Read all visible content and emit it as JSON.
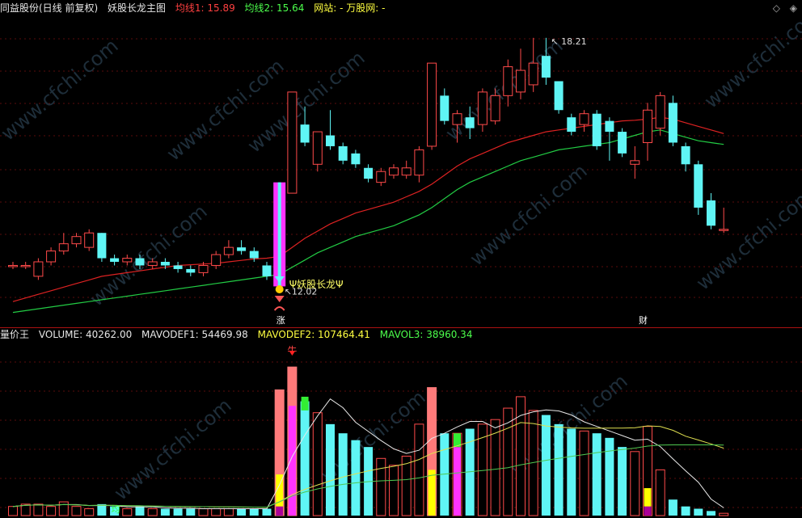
{
  "main_header": {
    "stock": "同益股份(日线 前复权)",
    "indicator": "妖股长龙主图",
    "ma1_label": "均线1: ",
    "ma1_value": "15.89",
    "ma2_label": "均线2: ",
    "ma2_value": "15.64",
    "site_label": "网站: - 万股网: -"
  },
  "volume_header": {
    "indicator": "量价王",
    "volume": "VOLUME: 40262.00",
    "mavodef1": "MAVODEF1: 54469.98",
    "mavodef2": "MAVODEF2: 107464.41",
    "mavol3": "MAVOL3: 38960.34"
  },
  "annotations": {
    "high_label": "18.21",
    "low_label": "12.02",
    "yaogu_label": "Ψ妖股长龙Ψ",
    "zhang": "涨",
    "cai": "财",
    "niu": "牛",
    "ma_tag": "均"
  },
  "watermark": "www.cfchi.com",
  "icons": {
    "diamond": "◇",
    "double_diamond": "◈"
  },
  "colors": {
    "up": "#ff4a4a",
    "down": "#5ff5f5",
    "ma_red": "#dd2222",
    "ma_green": "#22cc44",
    "vol_white": "#e8e8e8",
    "vol_yellow": "#e0e050",
    "vol_green": "#50c850",
    "magenta": "#ff33ff",
    "pink": "#ff7a7a"
  },
  "chart_data": {
    "type": "candlestick",
    "price_ylim": [
      11,
      19.5
    ],
    "candles": [
      {
        "o": 12.6,
        "c": 12.6,
        "h": 12.7,
        "l": 12.5
      },
      {
        "o": 12.6,
        "c": 12.6,
        "h": 12.7,
        "l": 12.5
      },
      {
        "o": 12.3,
        "c": 12.7,
        "h": 12.8,
        "l": 12.2
      },
      {
        "o": 12.7,
        "c": 13.0,
        "h": 13.1,
        "l": 12.6
      },
      {
        "o": 13.0,
        "c": 13.2,
        "h": 13.5,
        "l": 12.9
      },
      {
        "o": 13.2,
        "c": 13.4,
        "h": 13.5,
        "l": 13.1
      },
      {
        "o": 13.1,
        "c": 13.5,
        "h": 13.6,
        "l": 13.0
      },
      {
        "o": 13.5,
        "c": 12.8,
        "h": 13.5,
        "l": 12.7
      },
      {
        "o": 12.8,
        "c": 12.7,
        "h": 12.9,
        "l": 12.6
      },
      {
        "o": 12.7,
        "c": 12.8,
        "h": 12.9,
        "l": 12.6
      },
      {
        "o": 12.8,
        "c": 12.6,
        "h": 12.9,
        "l": 12.5
      },
      {
        "o": 12.6,
        "c": 12.7,
        "h": 12.8,
        "l": 12.5
      },
      {
        "o": 12.7,
        "c": 12.6,
        "h": 12.8,
        "l": 12.5
      },
      {
        "o": 12.6,
        "c": 12.5,
        "h": 12.7,
        "l": 12.4
      },
      {
        "o": 12.5,
        "c": 12.4,
        "h": 12.6,
        "l": 12.3
      },
      {
        "o": 12.4,
        "c": 12.6,
        "h": 12.7,
        "l": 12.3
      },
      {
        "o": 12.6,
        "c": 12.9,
        "h": 13.0,
        "l": 12.5
      },
      {
        "o": 12.9,
        "c": 13.1,
        "h": 13.3,
        "l": 12.8
      },
      {
        "o": 13.1,
        "c": 13.0,
        "h": 13.3,
        "l": 12.9
      },
      {
        "o": 13.0,
        "c": 12.8,
        "h": 13.1,
        "l": 12.7
      },
      {
        "o": 12.6,
        "c": 12.3,
        "h": 12.7,
        "l": 12.2
      },
      {
        "o": 12.02,
        "c": 14.9,
        "h": 14.9,
        "l": 12.02
      },
      {
        "o": 14.6,
        "c": 17.4,
        "h": 17.4,
        "l": 14.6
      },
      {
        "o": 16.5,
        "c": 16.0,
        "h": 17.0,
        "l": 15.9
      },
      {
        "o": 15.4,
        "c": 16.3,
        "h": 16.3,
        "l": 15.2
      },
      {
        "o": 16.2,
        "c": 15.9,
        "h": 16.9,
        "l": 15.8
      },
      {
        "o": 15.9,
        "c": 15.5,
        "h": 16.0,
        "l": 15.4
      },
      {
        "o": 15.7,
        "c": 15.4,
        "h": 15.8,
        "l": 15.3
      },
      {
        "o": 15.3,
        "c": 15.0,
        "h": 15.4,
        "l": 14.9
      },
      {
        "o": 14.9,
        "c": 15.2,
        "h": 15.3,
        "l": 14.8
      },
      {
        "o": 15.1,
        "c": 15.3,
        "h": 15.4,
        "l": 15.0
      },
      {
        "o": 15.1,
        "c": 15.3,
        "h": 15.5,
        "l": 15.0
      },
      {
        "o": 15.1,
        "c": 15.8,
        "h": 15.9,
        "l": 14.9
      },
      {
        "o": 15.9,
        "c": 18.2,
        "h": 18.2,
        "l": 15.8
      },
      {
        "o": 17.3,
        "c": 16.6,
        "h": 17.5,
        "l": 16.5
      },
      {
        "o": 16.5,
        "c": 16.8,
        "h": 16.9,
        "l": 16.0
      },
      {
        "o": 16.7,
        "c": 16.4,
        "h": 17.0,
        "l": 16.1
      },
      {
        "o": 16.5,
        "c": 17.4,
        "h": 17.5,
        "l": 16.3
      },
      {
        "o": 16.6,
        "c": 17.3,
        "h": 17.5,
        "l": 16.5
      },
      {
        "o": 17.3,
        "c": 18.1,
        "h": 18.3,
        "l": 17.0
      },
      {
        "o": 17.4,
        "c": 18.0,
        "h": 18.6,
        "l": 17.2
      },
      {
        "o": 17.6,
        "c": 18.2,
        "h": 18.9,
        "l": 17.4
      },
      {
        "o": 18.4,
        "c": 17.8,
        "h": 18.9,
        "l": 17.6
      },
      {
        "o": 17.7,
        "c": 16.9,
        "h": 17.7,
        "l": 16.8
      },
      {
        "o": 16.7,
        "c": 16.3,
        "h": 16.8,
        "l": 16.2
      },
      {
        "o": 16.5,
        "c": 16.8,
        "h": 16.9,
        "l": 16.3
      },
      {
        "o": 16.8,
        "c": 15.9,
        "h": 16.9,
        "l": 15.8
      },
      {
        "o": 16.6,
        "c": 16.3,
        "h": 16.7,
        "l": 15.5
      },
      {
        "o": 16.3,
        "c": 15.7,
        "h": 16.4,
        "l": 15.6
      },
      {
        "o": 15.4,
        "c": 15.5,
        "h": 15.9,
        "l": 15.0
      },
      {
        "o": 16.0,
        "c": 16.9,
        "h": 17.1,
        "l": 15.5
      },
      {
        "o": 16.4,
        "c": 17.3,
        "h": 17.4,
        "l": 16.2
      },
      {
        "o": 17.1,
        "c": 16.0,
        "h": 17.3,
        "l": 15.9
      },
      {
        "o": 15.9,
        "c": 15.4,
        "h": 16.0,
        "l": 15.2
      },
      {
        "o": 15.4,
        "c": 14.2,
        "h": 15.5,
        "l": 14.0
      },
      {
        "o": 14.4,
        "c": 13.7,
        "h": 14.6,
        "l": 13.6
      },
      {
        "o": 13.6,
        "c": 13.6,
        "h": 14.2,
        "l": 13.5
      }
    ],
    "ma1": [
      11.6,
      11.7,
      11.8,
      11.9,
      12.0,
      12.1,
      12.2,
      12.3,
      12.35,
      12.4,
      12.45,
      12.5,
      12.55,
      12.6,
      12.62,
      12.64,
      12.66,
      12.7,
      12.74,
      12.78,
      12.8,
      12.85,
      13.1,
      13.35,
      13.55,
      13.75,
      13.9,
      14.05,
      14.15,
      14.25,
      14.35,
      14.5,
      14.65,
      14.85,
      15.1,
      15.35,
      15.55,
      15.7,
      15.85,
      16.0,
      16.1,
      16.2,
      16.3,
      16.35,
      16.4,
      16.45,
      16.5,
      16.55,
      16.6,
      16.62,
      16.65,
      16.7,
      16.65,
      16.55,
      16.45,
      16.35,
      16.25
    ],
    "ma2": [
      11.3,
      11.35,
      11.4,
      11.45,
      11.5,
      11.55,
      11.6,
      11.65,
      11.7,
      11.75,
      11.8,
      11.85,
      11.9,
      11.95,
      12.0,
      12.05,
      12.1,
      12.15,
      12.2,
      12.25,
      12.3,
      12.35,
      12.55,
      12.75,
      12.95,
      13.1,
      13.25,
      13.4,
      13.5,
      13.6,
      13.7,
      13.85,
      14.0,
      14.2,
      14.45,
      14.7,
      14.9,
      15.05,
      15.2,
      15.35,
      15.5,
      15.6,
      15.7,
      15.8,
      15.85,
      15.9,
      15.95,
      16.0,
      16.1,
      16.2,
      16.3,
      16.35,
      16.25,
      16.15,
      16.05,
      16.0,
      15.95
    ],
    "volume": [
      4,
      5,
      5,
      4,
      6,
      4,
      3,
      5,
      4,
      3,
      4,
      3,
      3,
      3,
      3,
      3,
      3,
      3,
      3,
      3,
      3,
      55,
      65,
      50,
      45,
      40,
      36,
      33,
      30,
      25,
      22,
      26,
      40,
      56,
      36,
      36,
      38,
      40,
      42,
      47,
      52,
      46,
      44,
      40,
      38,
      37,
      36,
      34,
      30,
      28,
      39,
      20,
      7,
      4,
      3,
      2,
      1
    ],
    "vol_ylim": [
      0,
      70
    ]
  }
}
